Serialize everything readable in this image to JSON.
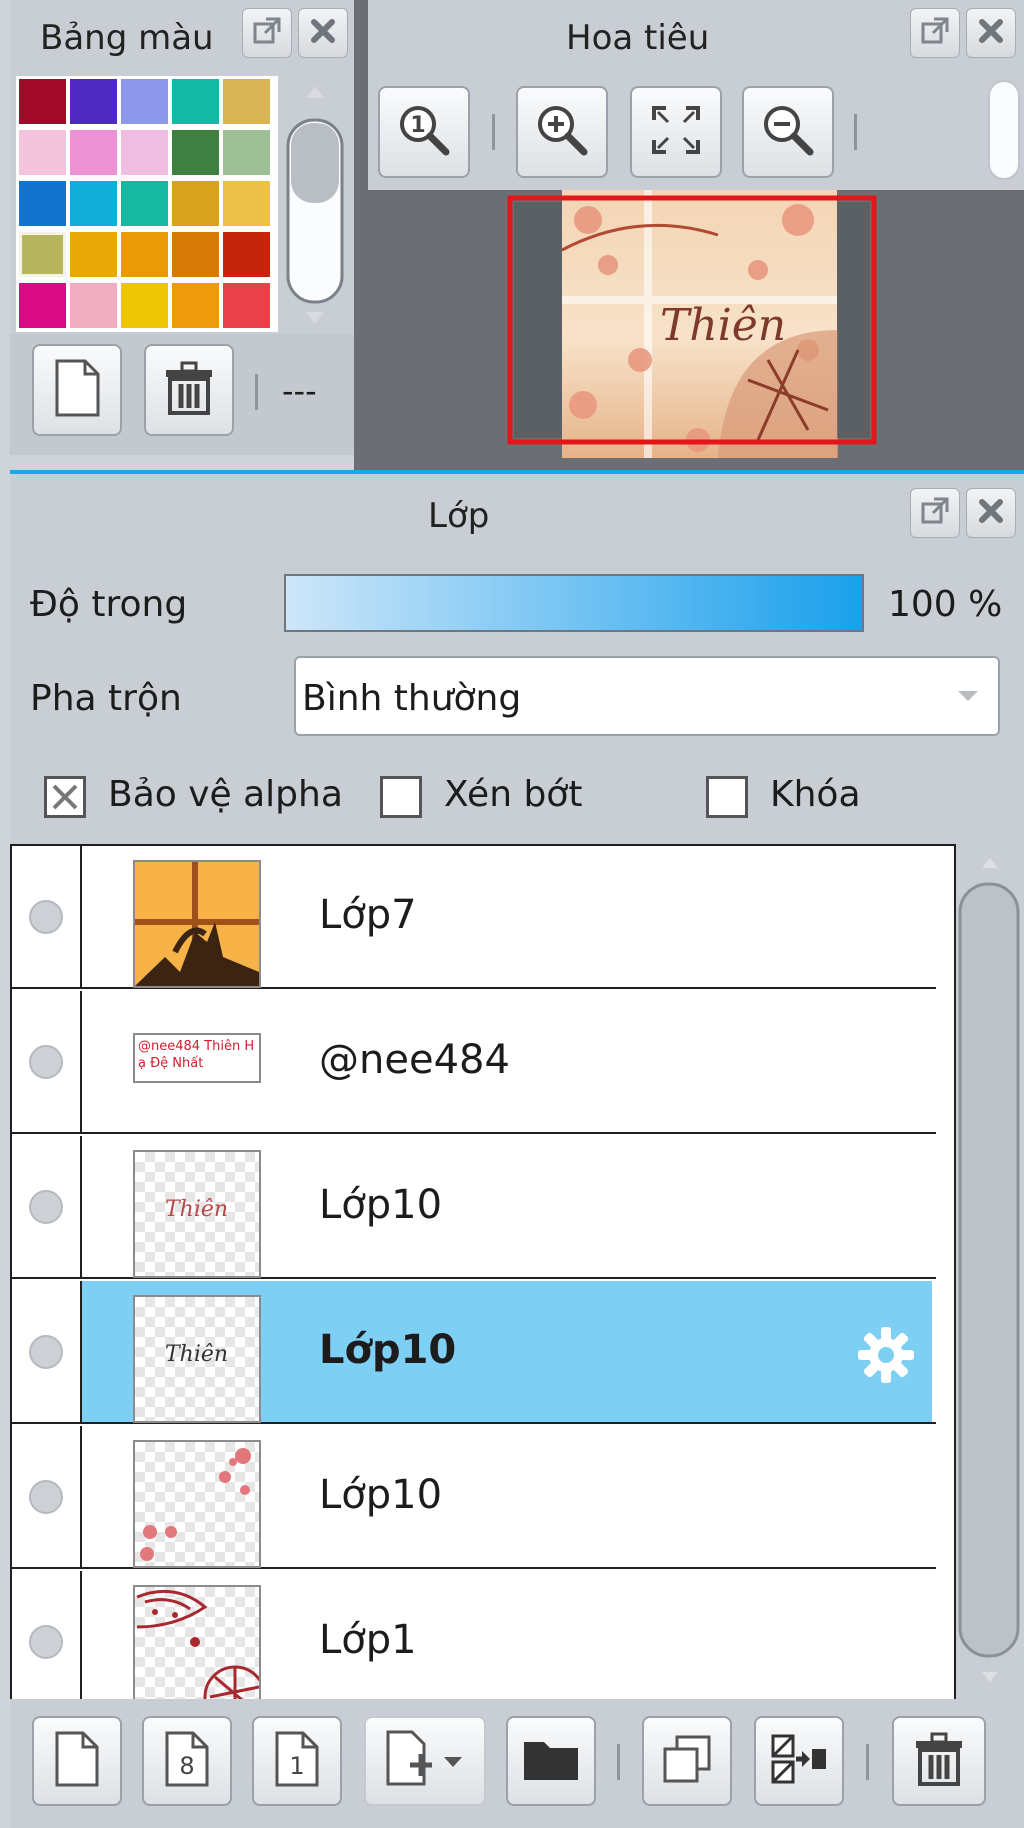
{
  "palette_panel": {
    "title": "Bảng màu",
    "swatches": [
      "#a3092b",
      "#4d2bc0",
      "#8d98ea",
      "#12b9a4",
      "#d8b454",
      "#f4c3dc",
      "#ee92d6",
      "#efbde1",
      "#3f7f41",
      "#9cbf95",
      "#1374cf",
      "#12aed8",
      "#16b8a0",
      "#d8a31c",
      "#ecc149",
      "#b7b55e",
      "#eaa806",
      "#eb9a07",
      "#d87a08",
      "#c5250d",
      "#d80b84",
      "#f0adbf",
      "#efc603",
      "#ef9a0b",
      "#e9414a"
    ],
    "selected_swatch": 15,
    "status_text": "---",
    "colors": {
      "panel_bg": "#c9ced4",
      "frame": "#7b8087"
    }
  },
  "navigator_panel": {
    "title": "Hoa tiêu",
    "preview_text": "Thiên",
    "colors": {
      "viewport_border": "#e3161a",
      "bg": "#6b6f74"
    }
  },
  "layers_panel": {
    "title": "Lớp",
    "opacity_label": "Độ trong",
    "opacity_value": 100,
    "opacity_text": "100 %",
    "blend_label": "Pha trộn",
    "blend_value": "Bình thường",
    "checkboxes": [
      {
        "label": "Bảo vệ alpha",
        "checked": true
      },
      {
        "label": "Xén bớt",
        "checked": false
      },
      {
        "label": "Khóa",
        "checked": false
      }
    ],
    "layers": [
      {
        "name": "Lớp7",
        "thumb": "photo",
        "selected": false
      },
      {
        "name": "@nee484",
        "thumb": "text",
        "thumb_text": "@nee484 Thiên Hạ Đệ Nhất",
        "selected": false
      },
      {
        "name": "Lớp10",
        "thumb": "signature-red",
        "thumb_text": "Thiên",
        "selected": false
      },
      {
        "name": "Lớp10",
        "thumb": "signature-dark",
        "thumb_text": "Thiên",
        "selected": true
      },
      {
        "name": "Lớp10",
        "thumb": "dots",
        "selected": false
      },
      {
        "name": "Lớp1",
        "thumb": "pattern",
        "selected": false
      }
    ],
    "colors": {
      "selected_row": "#7ecff4",
      "accent": "#17a8ee"
    }
  }
}
